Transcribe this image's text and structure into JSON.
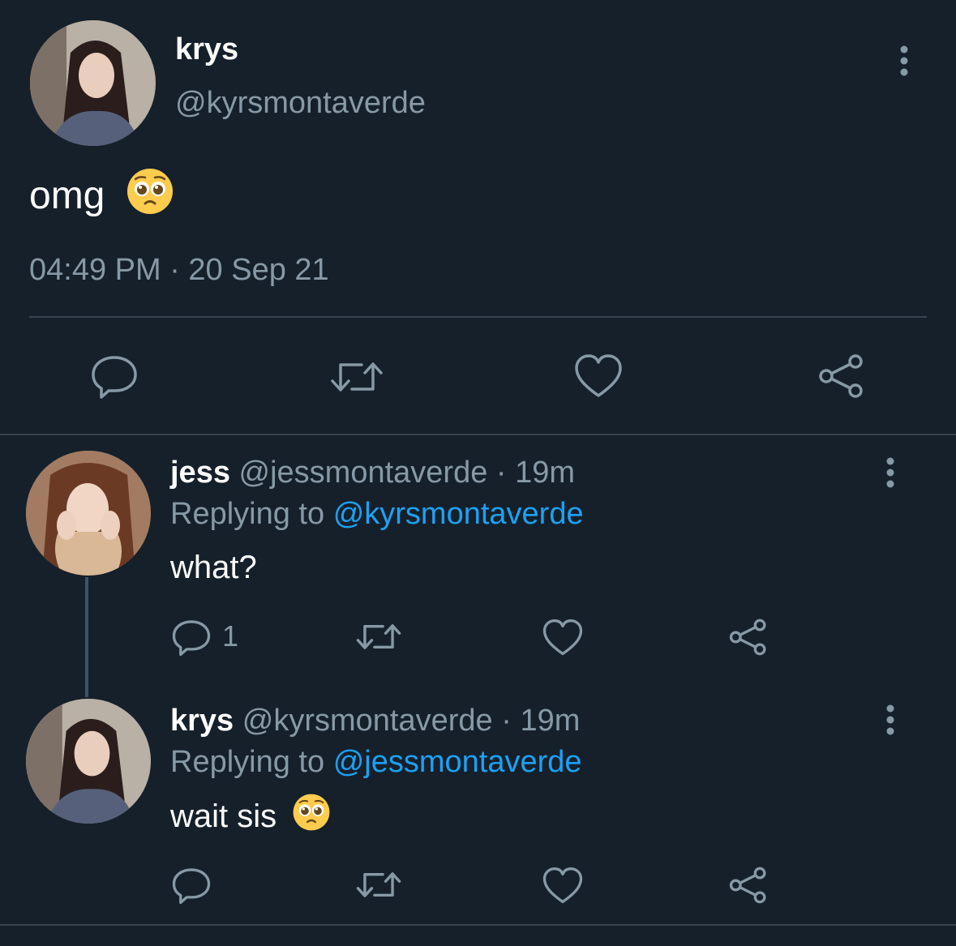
{
  "main_tweet": {
    "display_name": "krys",
    "handle": "@kyrsmontaverde",
    "text": "omg",
    "emoji": "pleading-face",
    "timestamp": "04:49 PM · 20 Sep 21"
  },
  "replies": [
    {
      "display_name": "jess",
      "handle": "@jessmontaverde",
      "time": "· 19m",
      "replying_prefix": "Replying to",
      "replying_to": "@kyrsmontaverde",
      "text": "what?",
      "reply_count": "1"
    },
    {
      "display_name": "krys",
      "handle": "@kyrsmontaverde",
      "time": "· 19m",
      "replying_prefix": "Replying to",
      "replying_to": "@jessmontaverde",
      "text": "wait sis",
      "emoji": "pleading-face"
    }
  ],
  "colors": {
    "background": "#15202b",
    "muted": "#8899a6",
    "link": "#1da1f2",
    "divider": "#38444d"
  }
}
